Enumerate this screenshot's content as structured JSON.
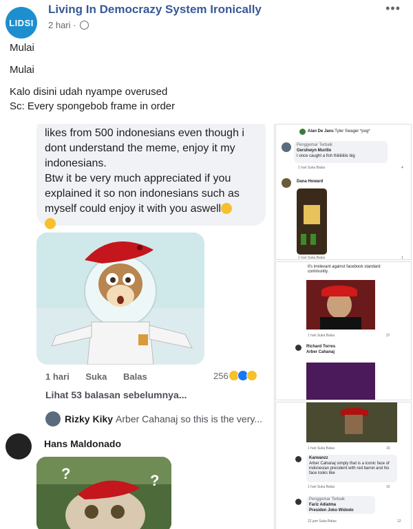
{
  "post": {
    "page_name": "Living In Democrazy System Ironically",
    "avatar_text": "LIDSI",
    "time": "2 hari",
    "more": "•••",
    "lines": [
      "Mulai",
      "Mulai",
      "Kalo disini udah nyampe overused",
      "Sc: Every spongebob frame in order"
    ]
  },
  "left": {
    "bubble_lines": [
      "likes from 500 indonesians even though i",
      "dont understand the meme, enjoy it my",
      "indonesians.",
      "Btw it be very much appreciated if you",
      "explained it so non indonesians such as",
      "myself could enjoy it with you aswell"
    ],
    "actions": [
      "1 hari",
      "Suka",
      "Balas"
    ],
    "reaction_count": "256",
    "prev_replies": "Lihat 53 balasan sebelumnya...",
    "reply_name": "Rizky Kiky",
    "reply_text": "Arber Cahanaj so this is the very...",
    "hans_name": "Hans Maldonado"
  },
  "right": {
    "p1_top": "Alan De Javu",
    "p1_top_text": "Tyler Swager *pog*",
    "p1_badge": "Penggemar Terbaik",
    "p1_name": "Gershwyn Murillo",
    "p1_text": "I once caught a fish thiiiiiiiiiis big",
    "p1_meta": "1 hari   Suka   Balas",
    "p1_count": "4",
    "p1_name2": "Dana Howard",
    "p1_meta2": "1 hari   Suka   Balas",
    "p1_count2": "1",
    "p2_text": "it's irrelevant against facebook standard community.",
    "p2_meta": "1 hari   Suka   Balas",
    "p2_count": "37",
    "p2_name": "Richard Torres",
    "p2_text2": "Arber Cahanaj",
    "p3_meta": "1 hari   Suka   Balas",
    "p3_count": "16",
    "p3_name": "Karwanzz",
    "p3_text": "Arber Cahanaj simply that is a iconic face of indonesian precident with red barret and his face looks like",
    "p3_meta2": "1 hari   Suka   Balas",
    "p3_count2": "16",
    "p3_badge": "Penggemar Terbaik",
    "p3_name2": "Fariz Adiatma",
    "p3_text2": "Presiden Joko Widodo",
    "p3_meta3": "22 jam   Suka   Balas",
    "p3_count3": "12"
  },
  "colors": {
    "link": "#385898",
    "bubble": "#f0f2f5",
    "beret": "#c4161c",
    "avatar": "#1d8fcf"
  }
}
